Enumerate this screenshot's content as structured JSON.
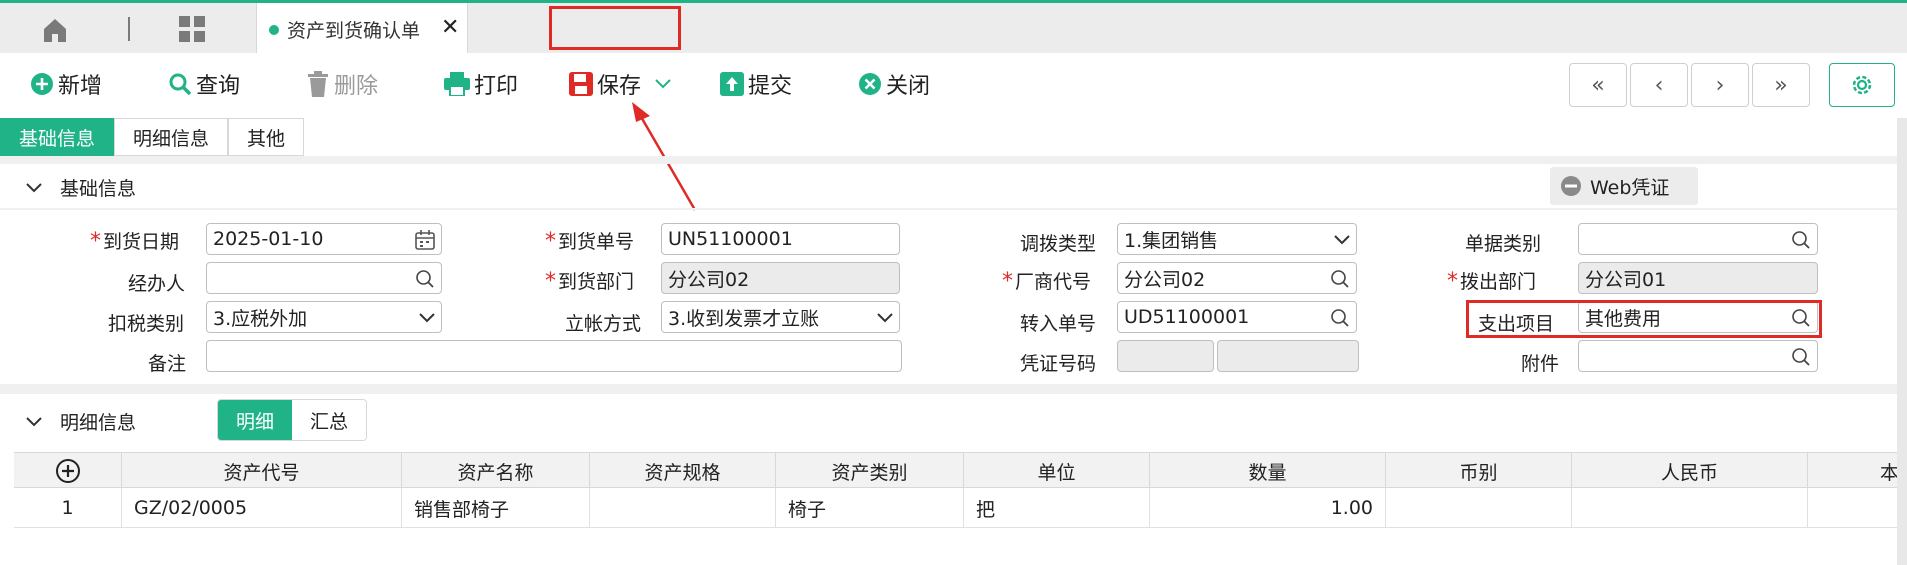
{
  "app": {
    "active_tab": "资产到货确认单",
    "accent_color": "#1fb387",
    "highlight_color": "#e02a26"
  },
  "toolbar": {
    "add": "新增",
    "query": "查询",
    "delete": "删除",
    "print": "打印",
    "save": "保存",
    "submit": "提交",
    "close": "关闭",
    "nav": [
      "«",
      "‹",
      "›",
      "»"
    ]
  },
  "section_tabs": [
    "基础信息",
    "明细信息",
    "其他"
  ],
  "basic_section": {
    "title": "基础信息",
    "web_voucher": "Web凭证"
  },
  "form": {
    "arrival_date_label": "到货日期",
    "arrival_date": "2025-01-10",
    "arrival_no_label": "到货单号",
    "arrival_no": "UN51100001",
    "transfer_type_label": "调拨类型",
    "transfer_type": "1.集团销售",
    "doc_category_label": "单据类别",
    "doc_category": "",
    "handler_label": "经办人",
    "handler": "",
    "arrival_dept_label": "到货部门",
    "arrival_dept": "分公司02",
    "vendor_code_label": "厂商代号",
    "vendor_code": "分公司02",
    "out_dept_label": "拨出部门",
    "out_dept": "分公司01",
    "tax_type_label": "扣税类别",
    "tax_type": "3.应税外加",
    "account_method_label": "立帐方式",
    "account_method": "3.收到发票才立账",
    "transfer_in_no_label": "转入单号",
    "transfer_in_no": "UD51100001",
    "expense_item_label": "支出项目",
    "expense_item": "其他费用",
    "remark_label": "备注",
    "remark": "",
    "voucher_no_label": "凭证号码",
    "attachment_label": "附件",
    "attachment": ""
  },
  "detail_section": {
    "title": "明细信息",
    "tabs": [
      "明细",
      "汇总"
    ]
  },
  "table": {
    "columns": [
      "资产代号",
      "资产名称",
      "资产规格",
      "资产类别",
      "单位",
      "数量",
      "币别",
      "人民币",
      "本"
    ],
    "rows": [
      {
        "idx": "1",
        "code": "GZ/02/0005",
        "name": "销售部椅子",
        "spec": "",
        "category": "椅子",
        "unit": "把",
        "qty": "1.00",
        "currency": "",
        "rmb": ""
      }
    ]
  }
}
